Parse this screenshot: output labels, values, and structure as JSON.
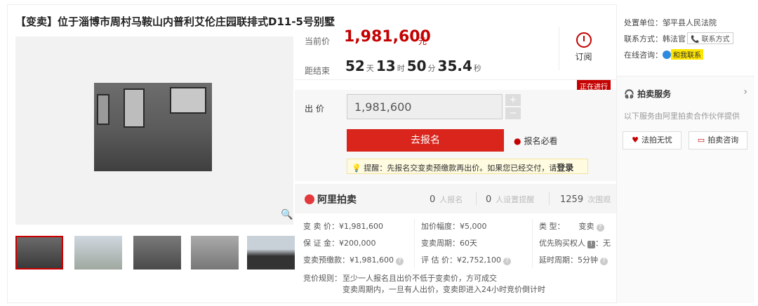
{
  "title": "【变卖】位于淄博市周村马鞍山内普利艾伦庄园联排式D11-5号别墅",
  "price": {
    "current_label": "当前价",
    "current_value": "1,981,600",
    "unit": "元",
    "countdown_label": "距结束",
    "days": "52",
    "days_unit": "天",
    "hours": "13",
    "hours_unit": "时",
    "minutes": "50",
    "minutes_unit": "分",
    "seconds": "35.4",
    "seconds_unit": "秒",
    "remind_label": "订阅"
  },
  "status_badge": "正在进行",
  "bid": {
    "label": "出 价",
    "value": "1,981,600",
    "plus": "+",
    "minus": "−",
    "signup_button": "去报名",
    "notice_link": "报名必看",
    "tip": "提醒：先报名交变卖预缴款再出价。如果您已经交付，请",
    "tip_login": "登录"
  },
  "stats": {
    "brand": "阿里拍卖",
    "signups_count": "0",
    "signups_label": "人报名",
    "reminders_count": "0",
    "reminders_label": "人设置提醒",
    "views_count": "1259",
    "views_label": "次围观"
  },
  "info": {
    "sell_price": "变 卖 价：¥1,981,600",
    "deposit": "保 证 金：¥200,000",
    "prepay": "变卖预缴款：¥1,981,600",
    "increment": "加价幅度：¥5,000",
    "period": "变卖周期：60天",
    "appraisal": "评 估 价：¥2,752,100",
    "type_label": "类    型：",
    "type_value": "变卖",
    "priority": "优先购买权人",
    "priority_value": "：无",
    "delay": "延时周期：5分钟",
    "rules_label": "竞价规则：",
    "rules_1": "至少一人报名且出价不低于变卖价，方可成交",
    "rules_2": "变卖周期内，一旦有人出价，变卖即进入24小时竞价倒计时"
  },
  "side": {
    "unit": "处置单位：邹平县人民法院",
    "contact": "联系方式：韩法官",
    "contact_btn": "联系方式",
    "consult": "在线咨询：",
    "contact_me": "和我联系",
    "service_title": "拍卖服务",
    "service_sub": "以下服务由阿里拍卖合作伙伴提供",
    "btn_law": "法拍无忧",
    "btn_consult": "拍卖咨询"
  },
  "colors": {
    "accent": "#d9251c",
    "price": "#c40000"
  }
}
